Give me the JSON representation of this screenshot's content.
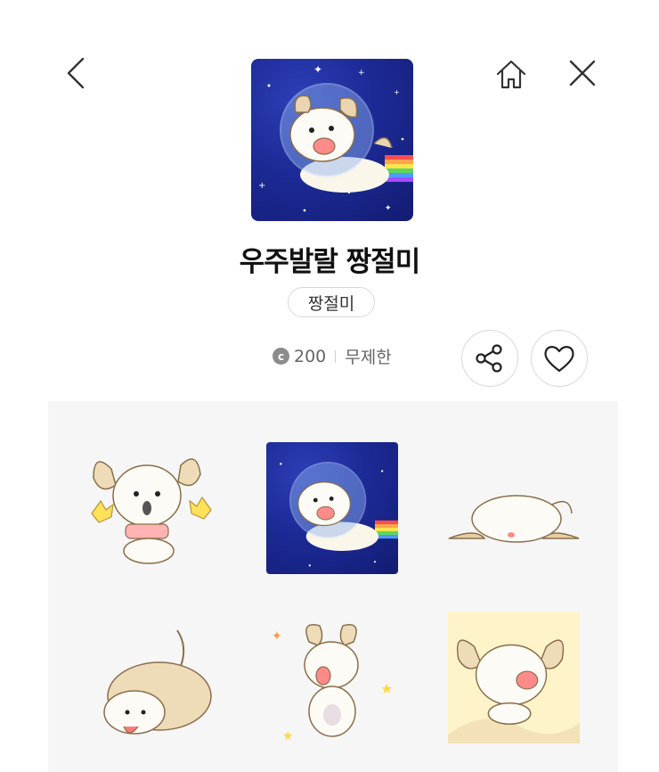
{
  "product": {
    "title": "우주발랄 짱절미",
    "author": "짱절미",
    "coin_symbol": "c",
    "price": "200",
    "period": "무제한"
  },
  "icons": {
    "back": "chevron-left-icon",
    "home": "home-icon",
    "close": "close-icon",
    "share": "share-icon",
    "like": "heart-icon"
  },
  "colors": {
    "space_bg": "#1c2a96",
    "panel_bg": "#f6f6f6"
  },
  "stickers": [
    "sticker-1",
    "sticker-2",
    "sticker-3",
    "sticker-4",
    "sticker-5",
    "sticker-6"
  ]
}
